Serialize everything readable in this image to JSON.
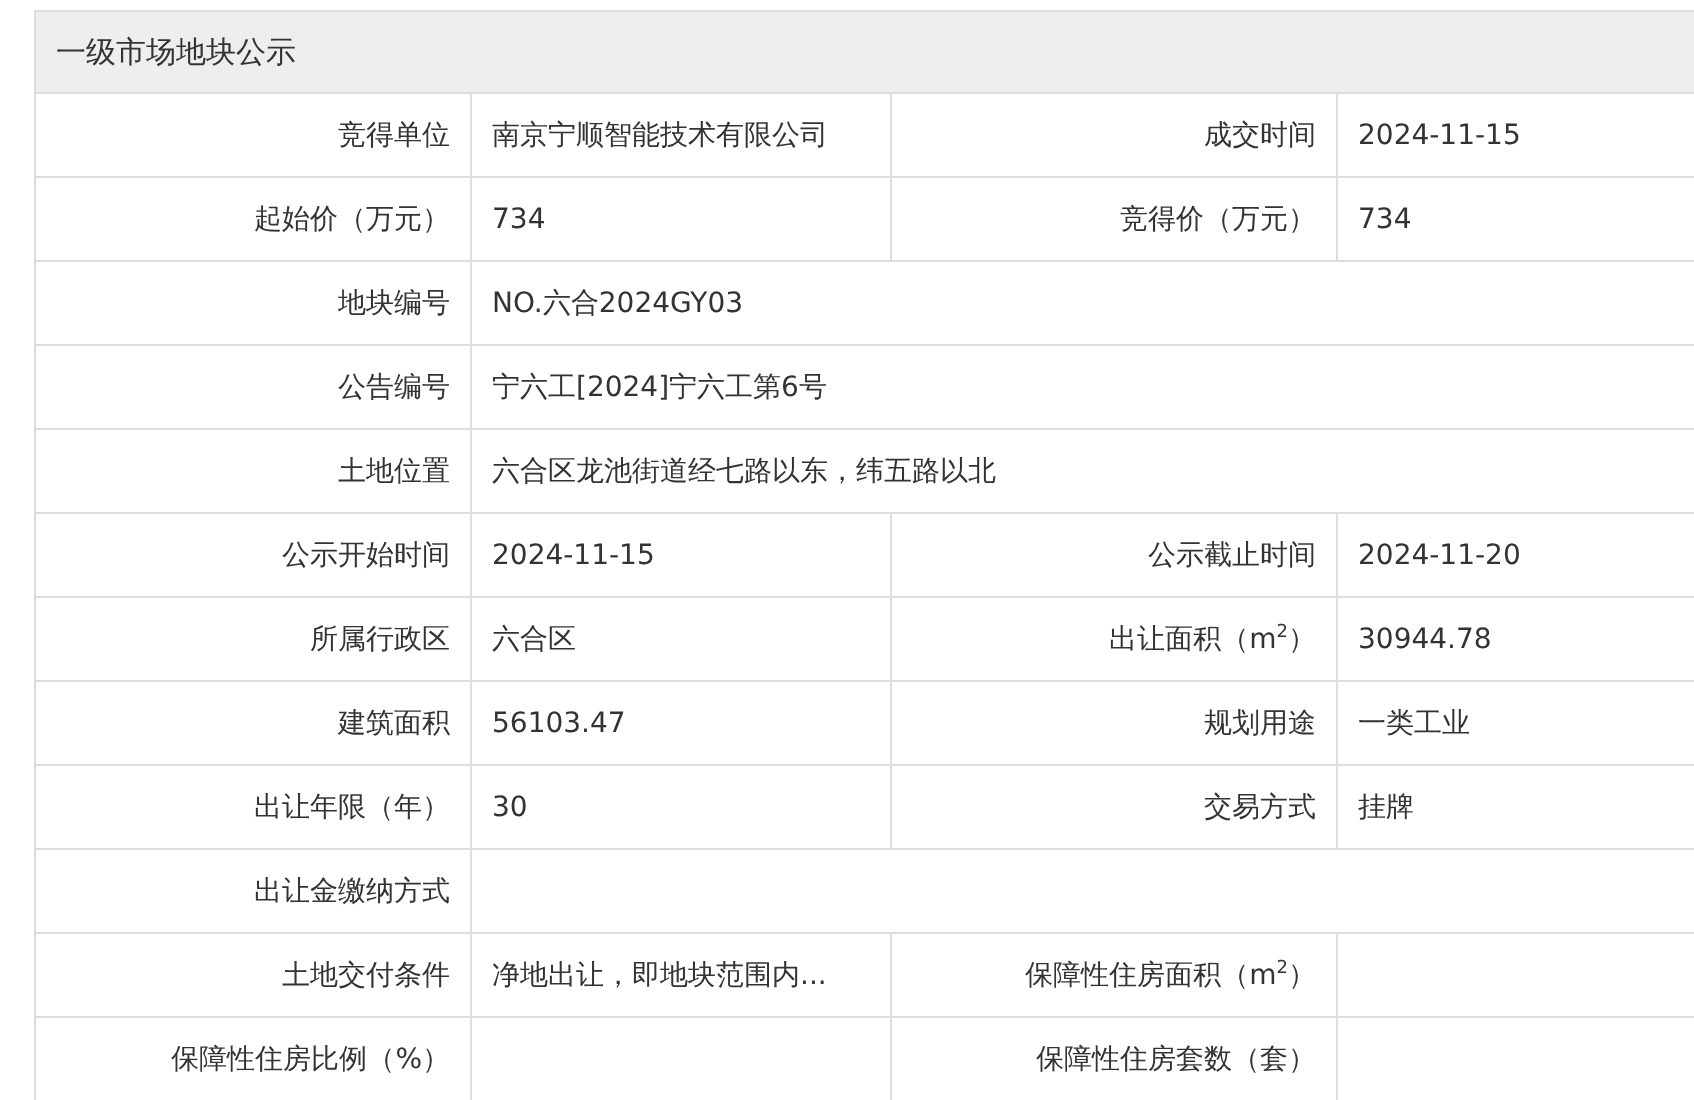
{
  "title": "一级市场地块公示",
  "rows": [
    {
      "fields": [
        {
          "label": "竞得单位",
          "value": "南京宁顺智能技术有限公司"
        },
        {
          "label": "成交时间",
          "value": "2024-11-15"
        }
      ]
    },
    {
      "fields": [
        {
          "label": "起始价（万元）",
          "value": "734"
        },
        {
          "label": "竞得价（万元）",
          "value": "734"
        }
      ]
    },
    {
      "fields": [
        {
          "label": "地块编号",
          "value": "NO.六合2024GY03"
        }
      ]
    },
    {
      "fields": [
        {
          "label": "公告编号",
          "value": "宁六工[2024]宁六工第6号"
        }
      ]
    },
    {
      "fields": [
        {
          "label": "土地位置",
          "value": "六合区龙池街道经七路以东，纬五路以北"
        }
      ]
    },
    {
      "fields": [
        {
          "label": "公示开始时间",
          "value": "2024-11-15"
        },
        {
          "label": "公示截止时间",
          "value": "2024-11-20"
        }
      ]
    },
    {
      "fields": [
        {
          "label": "所属行政区",
          "value": "六合区"
        },
        {
          "label": "出让面积（m$^{2}$）",
          "value": "30944.78"
        }
      ]
    },
    {
      "fields": [
        {
          "label": "建筑面积",
          "value": "56103.47"
        },
        {
          "label": "规划用途",
          "value": "一类工业"
        }
      ]
    },
    {
      "fields": [
        {
          "label": "出让年限（年）",
          "value": "30"
        },
        {
          "label": "交易方式",
          "value": "挂牌"
        }
      ]
    },
    {
      "fields": [
        {
          "label": "出让金缴纳方式"
        }
      ]
    },
    {
      "fields": [
        {
          "label": "土地交付条件",
          "value": "净地出让，即地块范围内..."
        },
        {
          "label": "保障性住房面积（m$^{2}$）"
        }
      ]
    },
    {
      "fields": [
        {
          "label": "保障性住房比例（%）"
        },
        {
          "label": "保障性住房套数（套）"
        }
      ]
    }
  ]
}
